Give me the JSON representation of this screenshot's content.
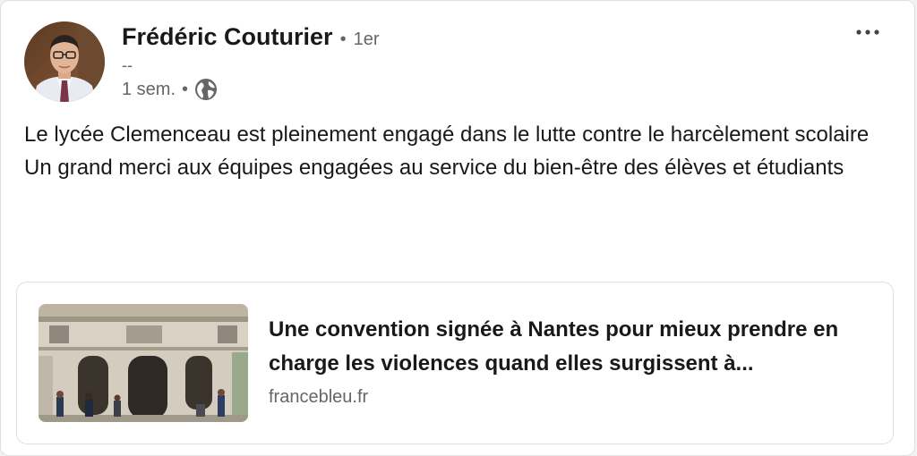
{
  "post": {
    "author": {
      "name": "Frédéric Couturier",
      "separator": "•",
      "degree": "1er",
      "headline": "--"
    },
    "time": "1 sem.",
    "time_separator": "•",
    "visibility_icon": "globe-icon",
    "more_icon": "ellipsis-icon",
    "text_lines": [
      "Le lycée Clemenceau est pleinement engagé dans le lutte contre le harcèlement scolaire",
      "Un grand merci aux équipes engagées au service du bien-être des élèves et étudiants"
    ]
  },
  "link_preview": {
    "title": "Une convention signée à Nantes pour mieux prendre en charge les violences quand elles surgissent à...",
    "domain": "francebleu.fr"
  },
  "colors": {
    "text_primary": "#191919",
    "text_secondary": "#666666",
    "border": "#e0dfdc",
    "background": "#ffffff"
  }
}
